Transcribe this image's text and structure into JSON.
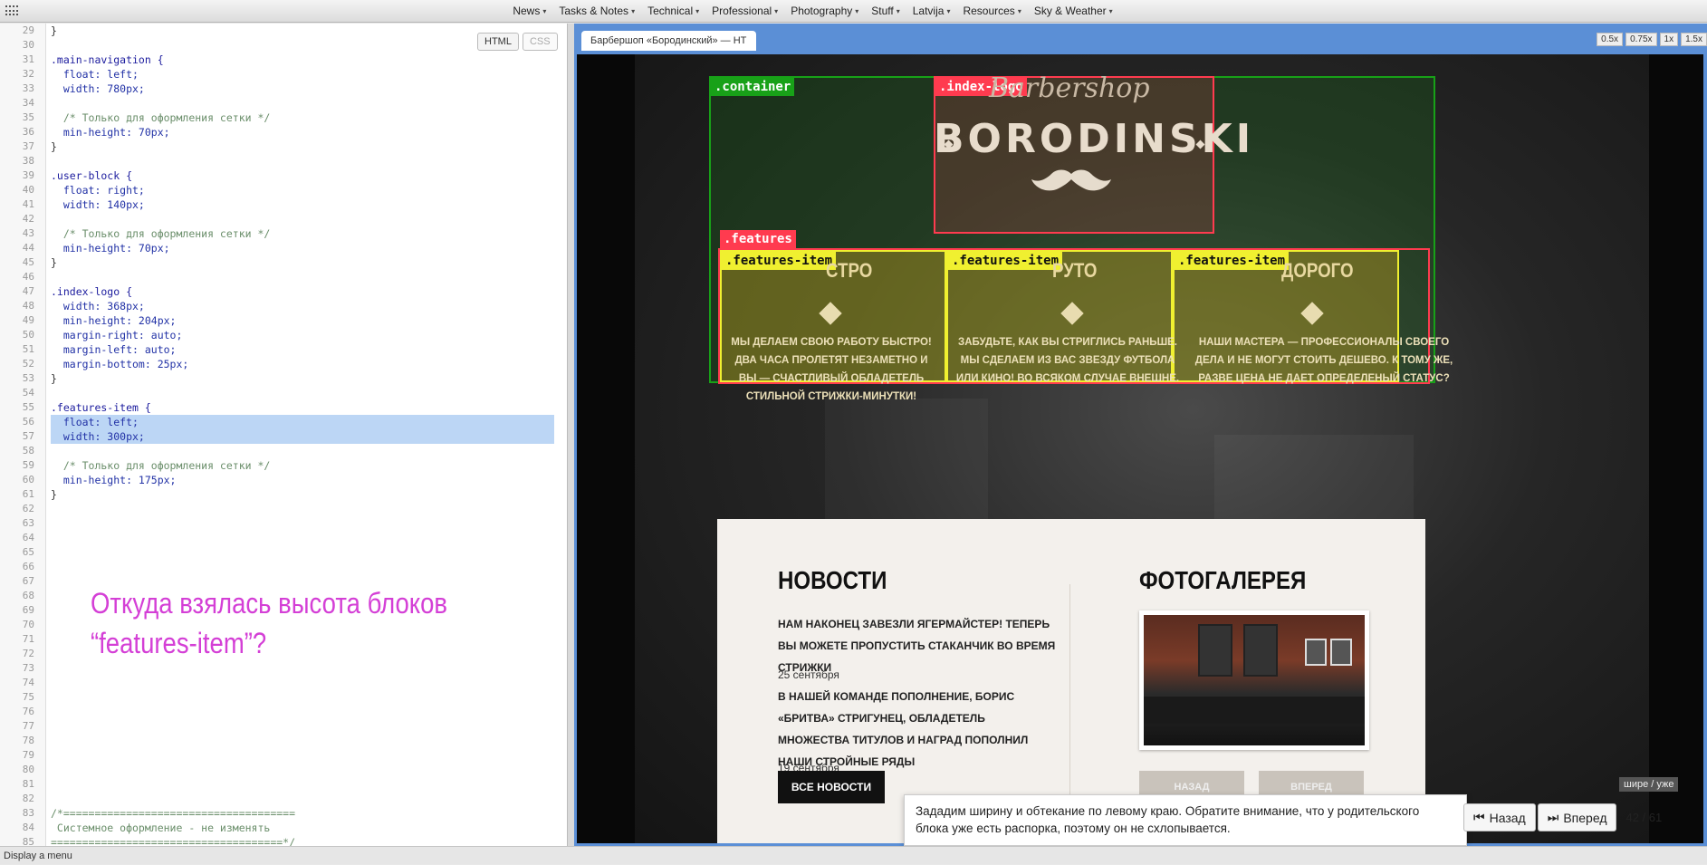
{
  "menu": [
    "News",
    "Tasks & Notes",
    "Technical",
    "Professional",
    "Photography",
    "Stuff",
    "Latvija",
    "Resources",
    "Sky & Weather"
  ],
  "editor_tabs": {
    "html": "HTML",
    "css": "CSS"
  },
  "code_lines": [
    {
      "n": "29",
      "t": "}"
    },
    {
      "n": "30",
      "t": ""
    },
    {
      "n": "31",
      "t": ".main-navigation {"
    },
    {
      "n": "32",
      "t": "  float: left;"
    },
    {
      "n": "33",
      "t": "  width: 780px;"
    },
    {
      "n": "34",
      "t": ""
    },
    {
      "n": "35",
      "t": "  /* Только для оформления сетки */"
    },
    {
      "n": "36",
      "t": "  min-height: 70px;"
    },
    {
      "n": "37",
      "t": "}"
    },
    {
      "n": "38",
      "t": ""
    },
    {
      "n": "39",
      "t": ".user-block {"
    },
    {
      "n": "40",
      "t": "  float: right;"
    },
    {
      "n": "41",
      "t": "  width: 140px;"
    },
    {
      "n": "42",
      "t": ""
    },
    {
      "n": "43",
      "t": "  /* Только для оформления сетки */"
    },
    {
      "n": "44",
      "t": "  min-height: 70px;"
    },
    {
      "n": "45",
      "t": "}"
    },
    {
      "n": "46",
      "t": ""
    },
    {
      "n": "47",
      "t": ".index-logo {"
    },
    {
      "n": "48",
      "t": "  width: 368px;"
    },
    {
      "n": "49",
      "t": "  min-height: 204px;"
    },
    {
      "n": "50",
      "t": "  margin-right: auto;"
    },
    {
      "n": "51",
      "t": "  margin-left: auto;"
    },
    {
      "n": "52",
      "t": "  margin-bottom: 25px;"
    },
    {
      "n": "53",
      "t": "}"
    },
    {
      "n": "54",
      "t": ""
    },
    {
      "n": "55",
      "t": ".features-item {"
    },
    {
      "n": "56",
      "t": "  float: left;"
    },
    {
      "n": "57",
      "t": "  width: 300px;"
    },
    {
      "n": "58",
      "t": ""
    },
    {
      "n": "59",
      "t": "  /* Только для оформления сетки */"
    },
    {
      "n": "60",
      "t": "  min-height: 175px;"
    },
    {
      "n": "61",
      "t": "}"
    },
    {
      "n": "62",
      "t": ""
    },
    {
      "n": "63",
      "t": ""
    },
    {
      "n": "64",
      "t": ""
    },
    {
      "n": "65",
      "t": ""
    },
    {
      "n": "66",
      "t": ""
    },
    {
      "n": "67",
      "t": ""
    },
    {
      "n": "68",
      "t": ""
    },
    {
      "n": "69",
      "t": ""
    },
    {
      "n": "70",
      "t": ""
    },
    {
      "n": "71",
      "t": ""
    },
    {
      "n": "72",
      "t": ""
    },
    {
      "n": "73",
      "t": ""
    },
    {
      "n": "74",
      "t": ""
    },
    {
      "n": "75",
      "t": ""
    },
    {
      "n": "76",
      "t": ""
    },
    {
      "n": "77",
      "t": ""
    },
    {
      "n": "78",
      "t": ""
    },
    {
      "n": "79",
      "t": ""
    },
    {
      "n": "80",
      "t": ""
    },
    {
      "n": "81",
      "t": ""
    },
    {
      "n": "82",
      "t": ""
    },
    {
      "n": "83",
      "t": "/*====================================="
    },
    {
      "n": "84",
      "t": " Системное оформление - не изменять"
    },
    {
      "n": "85",
      "t": "=====================================*/"
    }
  ],
  "question": {
    "line1": "Откуда взялась высота блоков",
    "line2": "“features-item”?"
  },
  "preview": {
    "tab_title": "Барбершоп «Бородинский» — HT",
    "zoom": [
      "0.5x",
      "0.75x",
      "1x",
      "1.5x"
    ],
    "labels": {
      "container": ".container",
      "logo": ".index-logo",
      "features": ".features",
      "item": ".features-item"
    },
    "logo": {
      "script": "Barbershop",
      "main": "BORODINSKI"
    },
    "features": [
      {
        "head": "СТРО",
        "text": "МЫ ДЕЛАЕМ СВОЮ РАБОТУ БЫСТРО! ДВА ЧАСА ПРОЛЕТЯТ НЕЗАМЕТНО И ВЫ — СЧАСТЛИВЫЙ ОБЛАДЕТЕЛЬ СТИЛЬНОЙ СТРИЖКИ-МИНУТКИ!"
      },
      {
        "head": "РУТО",
        "text": "ЗАБУДЬТЕ, КАК ВЫ СТРИГЛИСЬ РАНЬШЕ. МЫ СДЕЛАЕМ ИЗ ВАС ЗВЕЗДУ ФУТБОЛА ИЛИ КИНО! ВО ВСЯКОМ СЛУЧАЕ ВНЕШНЕ."
      },
      {
        "head": "ДОРОГО",
        "text": "НАШИ МАСТЕРА — ПРОФЕССИОНАЛЫ СВОЕГО ДЕЛА И НЕ МОГУТ СТОИТЬ ДЕШЕВО. К ТОМУ ЖЕ, РАЗВЕ ЦЕНА НЕ ДАЕТ ОПРЕДЕЛЕНЫЙ СТАТУС?"
      }
    ],
    "news": {
      "title": "НОВОСТИ",
      "items": [
        {
          "text": "НАМ НАКОНЕЦ ЗАВЕЗЛИ ЯГЕРМАЙСТЕР! ТЕПЕРЬ ВЫ МОЖЕТЕ ПРОПУСТИТЬ СТАКАНЧИК ВО ВРЕМЯ СТРИЖКИ",
          "date": "25 сентября"
        },
        {
          "text": "В НАШЕЙ КОМАНДЕ ПОПОЛНЕНИЕ, БОРИС «БРИТВА» СТРИГУНЕЦ, ОБЛАДЕТЕЛЬ МНОЖЕСТВА ТИТУЛОВ И НАГРАД ПОПОЛНИЛ НАШИ СТРОЙНЫЕ РЯДЫ",
          "date": "19 сентября"
        }
      ],
      "all_button": "ВСЕ НОВОСТИ"
    },
    "gallery": {
      "title": "ФОТОГАЛЕРЕЯ",
      "back": "НАЗАД",
      "forward": "ВПЕРЕД"
    }
  },
  "tooltip": "Зададим ширину и обтекание по левому краю. Обратите внимание, что у родительского блока уже есть распорка, поэтому он не схлопывается.",
  "nav": {
    "back": "Назад",
    "forward": "Вперед",
    "counter": "42 / 61",
    "narrow": "шире / уже"
  },
  "status": "Display a menu",
  "colors": {
    "container": "#18a118",
    "logo_outline": "#ff3b4f",
    "item_outline": "#f0f030",
    "question": "#d43fd6",
    "preview_frame": "#5b8fd6"
  }
}
